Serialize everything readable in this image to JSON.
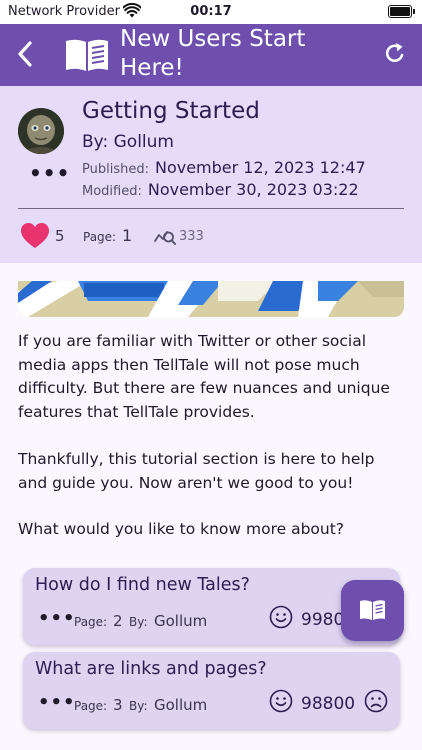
{
  "status_bar": {
    "carrier": "Network Provider",
    "time": "00:17"
  },
  "nav": {
    "title": "New Users Start Here!",
    "icons": [
      "back-icon",
      "book-icon",
      "refresh-icon"
    ]
  },
  "post": {
    "title": "Getting Started",
    "author_label": "By:",
    "author": "Gollum",
    "published_label": "Published:",
    "published": "November 12, 2023 12:47",
    "modified_label": "Modified:",
    "modified": "November 30, 2023 03:22",
    "likes": "5",
    "page_label": "Page:",
    "page": "1",
    "views": "333"
  },
  "body": {
    "paragraph1": "If you are familiar with Twitter or other social media apps then TellTale will not pose much difficulty.  But there are few nuances and unique features that TellTale provides.",
    "paragraph2": "Thankfully, this tutorial section is here to help and guide you.  Now aren't we good to you!",
    "paragraph3": "What would you like to know more about?"
  },
  "cards": [
    {
      "title": "How do I find new Tales?",
      "page_label": "Page:",
      "page": "2",
      "by_label": "By:",
      "author": "Gollum",
      "count": "9980"
    },
    {
      "title": "What are links and pages?",
      "page_label": "Page:",
      "page": "3",
      "by_label": "By:",
      "author": "Gollum",
      "count": "98800"
    }
  ],
  "colors": {
    "nav_purple": "#6e4fad",
    "header_lavender": "#e6dcfa",
    "heart_pink": "#e8336e",
    "card_bg": "#ded3f1"
  }
}
